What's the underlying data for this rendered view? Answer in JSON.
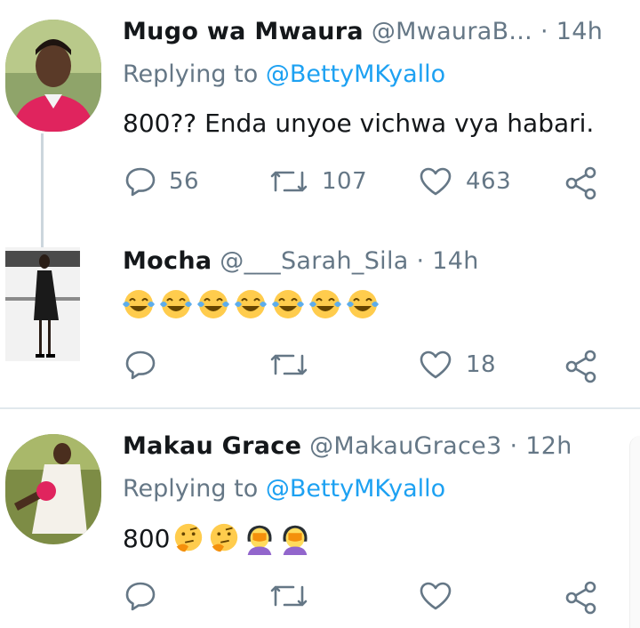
{
  "tweets": [
    {
      "name": "Mugo wa Mwaura",
      "handle": "@MwauraB...",
      "separator": "·",
      "time": "14h",
      "replying_prefix": "Replying to ",
      "replying_to": "@BettyMKyallo",
      "text": "800?? Enda unyoe vichwa vya habari.",
      "reply_count": "56",
      "retweet_count": "107",
      "like_count": "463"
    },
    {
      "name": "Mocha",
      "handle": "@___Sarah_Sila",
      "separator": "·",
      "time": "14h",
      "emoji_count": 7,
      "emoji_name": "face-with-tears-of-joy",
      "reply_count": "",
      "retweet_count": "",
      "like_count": "18"
    },
    {
      "name": "Makau Grace",
      "handle": "@MakauGrace3",
      "separator": "·",
      "time": "12h",
      "replying_prefix": "Replying to ",
      "replying_to": "@BettyMKyallo",
      "text": "800",
      "emojis": [
        "thinking-face",
        "thinking-face",
        "woman-facepalming",
        "woman-facepalming"
      ],
      "reply_count": "",
      "retweet_count": "",
      "like_count": ""
    }
  ],
  "icons": {
    "reply": "reply-icon",
    "retweet": "retweet-icon",
    "like": "heart-icon",
    "share": "share-icon"
  },
  "colors": {
    "link": "#1da1f2",
    "secondary_text": "#657786",
    "divider": "#e1e8ed"
  }
}
